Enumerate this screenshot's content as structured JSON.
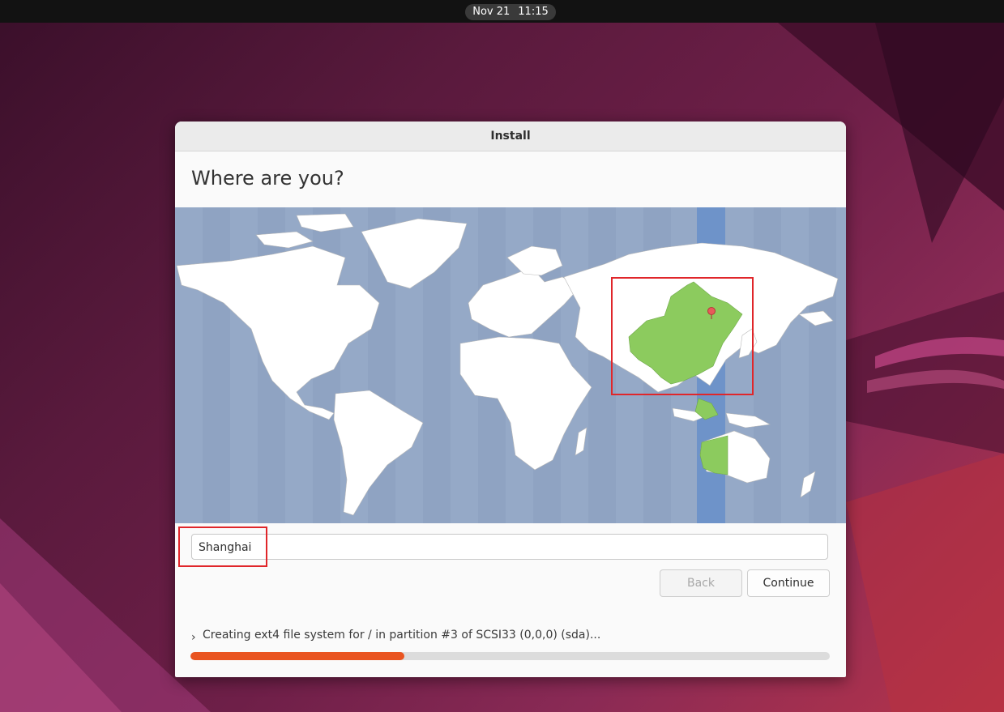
{
  "topbar": {
    "date": "Nov 21",
    "time": "11:15"
  },
  "window": {
    "title": "Install",
    "heading": "Where are you?",
    "timezone_input": {
      "value": "Shanghai"
    },
    "buttons": {
      "back": "Back",
      "continue": "Continue"
    },
    "progress": {
      "status": "Creating ext4 file system for / in partition #3 of SCSI33 (0,0,0) (sda)...",
      "fraction": 0.335
    }
  },
  "colors": {
    "accent": "#e95420",
    "map_ocean": "#95a9c7",
    "map_land": "#ffffff",
    "selected_region": "#8ccb5e",
    "highlight": "#e0262a"
  }
}
